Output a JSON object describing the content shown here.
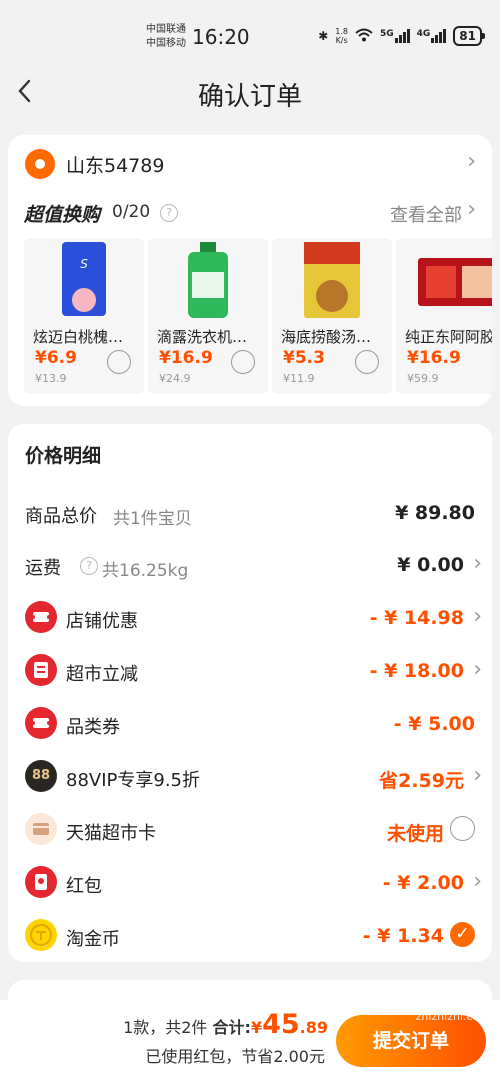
{
  "status_bar": {
    "carrier1": "中国联通",
    "carrier2": "中国移动",
    "time": "16:20",
    "speed_value": "1.8",
    "speed_unit": "K/s",
    "net1": "5G",
    "net2": "4G",
    "battery": "81"
  },
  "nav": {
    "title": "确认订单"
  },
  "address": {
    "text": "山东54789"
  },
  "exchange": {
    "title": "超值换购",
    "count": "0/20",
    "see_all": "查看全部",
    "products": [
      {
        "name": "炫迈白桃槐…",
        "price": "¥6.9",
        "orig": "¥13.9"
      },
      {
        "name": "滴露洗衣机…",
        "price": "¥16.9",
        "orig": "¥24.9"
      },
      {
        "name": "海底捞酸汤…",
        "price": "¥5.3",
        "orig": "¥11.9"
      },
      {
        "name": "纯正东阿阿胶",
        "price": "¥16.9",
        "orig": "¥59.9"
      }
    ]
  },
  "price_detail": {
    "title": "价格明细",
    "goods_label": "商品总价",
    "goods_sub": "共1件宝贝",
    "goods_value": "¥ 89.80",
    "shipping_label": "运费",
    "shipping_sub": "共16.25kg",
    "shipping_value": "¥ 0.00",
    "shop_discount_label": "店铺优惠",
    "shop_discount_value": "- ¥ 14.98",
    "market_cut_label": "超市立减",
    "market_cut_value": "- ¥ 18.00",
    "category_coupon_label": "品类券",
    "category_coupon_value": "- ¥ 5.00",
    "vip_label": "88VIP专享9.5折",
    "vip_value": "省2.59元",
    "vip_badge": "88",
    "card_label": "天猫超市卡",
    "card_value": "未使用",
    "redpack_label": "红包",
    "redpack_value": "- ¥ 2.00",
    "coin_label": "淘金币",
    "coin_value": "- ¥ 1.34"
  },
  "bottom_bar": {
    "summary_prefix": "1款，共2件",
    "total_label": "合计:",
    "total_currency": "¥",
    "total_int": "45",
    "total_dec": ".89",
    "saved_text": "已使用红包，节省2.00元",
    "submit_label": "提交订单"
  },
  "watermark": "zhizhizhi.com",
  "colors": {
    "accent": "#ff5000",
    "accent_light": "#ff9a00",
    "coupon_red": "#e4262f",
    "page_bg": "#f2f2f2"
  }
}
